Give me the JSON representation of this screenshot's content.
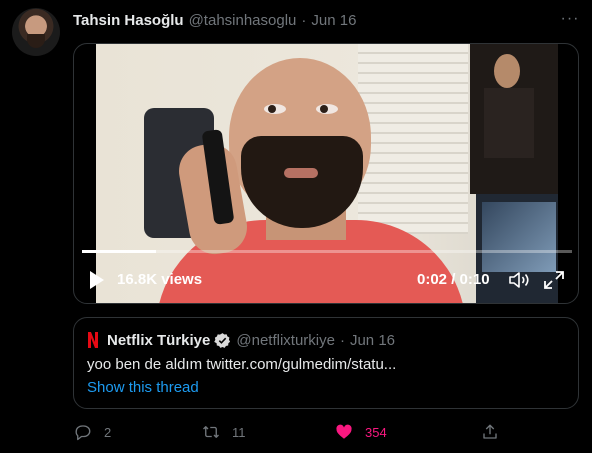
{
  "tweet": {
    "author_name": "Tahsin Hasoğlu",
    "author_handle": "@tahsinhasoglu",
    "separator": "·",
    "date": "Jun 16",
    "more_label": "···"
  },
  "video": {
    "views": "16.8K views",
    "time": "0:02 / 0:10",
    "progress": 0.15
  },
  "quote": {
    "name": "Netflix Türkiye",
    "handle": "@netflixturkiye",
    "separator": "·",
    "date": "Jun 16",
    "text": "yoo ben de aldım twitter.com/gulmedim/statu...",
    "show_thread": "Show this thread"
  },
  "actions": {
    "replies": "2",
    "retweets": "11",
    "likes": "354"
  },
  "colors": {
    "background": "#000000",
    "link": "#1d9bf0",
    "like": "#f91880",
    "muted": "#71767b",
    "netflix": "#e50914"
  }
}
